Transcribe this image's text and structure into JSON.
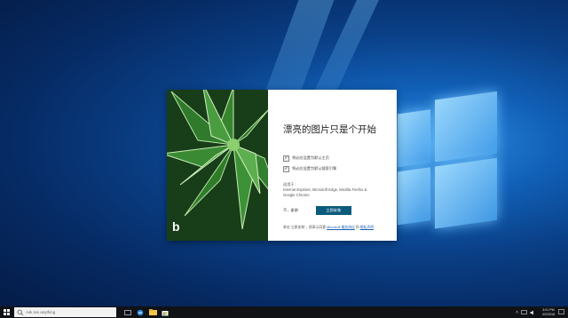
{
  "dialog": {
    "title": "漂亮的图片只是个开始",
    "options": [
      "将必应设置为默认主页",
      "将必应设置为默认搜索引擎"
    ],
    "applies_to_label": "适用于:",
    "applies_to_browsers": "Internet Explorer, Microsoft Edge, Mozilla Firefox & Google Chrome",
    "decline_label": "不，谢谢",
    "accept_label": "立即安装",
    "terms_prefix": "单击“立即安装”，即表示同意",
    "terms_link": "Microsoft 服务协议",
    "terms_and": "和",
    "terms_link2": "隐私声明",
    "logo_text": "b"
  },
  "taskbar": {
    "search_placeholder": "Ask me anything",
    "clock_time": "3:01 PM",
    "clock_date": "4/2/2018"
  },
  "colors": {
    "install_button": "#0b5b7d",
    "taskbar": "#101216",
    "desktop": "#0a3f86"
  }
}
